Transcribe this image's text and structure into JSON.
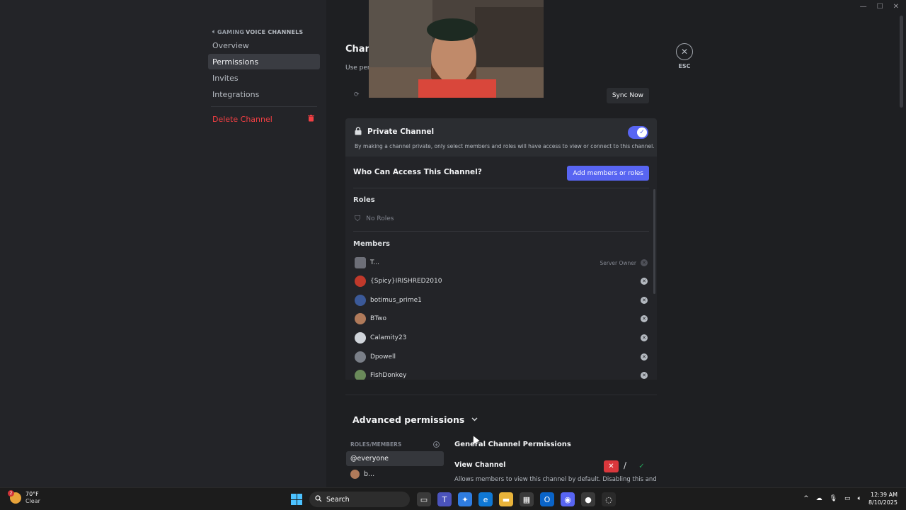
{
  "window": {
    "minimize": "—",
    "maximize": "☐",
    "close": "✕"
  },
  "sidebar": {
    "header_category": "GAMING",
    "header_group": "VOICE CHANNELS",
    "items": [
      {
        "label": "Overview"
      },
      {
        "label": "Permissions"
      },
      {
        "label": "Invites"
      },
      {
        "label": "Integrations"
      }
    ],
    "delete_label": "Delete Channel"
  },
  "page": {
    "title": "Chann",
    "subtitle": "Use perm",
    "sync_label": "Sync Now",
    "esc_label": "ESC"
  },
  "private_channel": {
    "title": "Private Channel",
    "description": "By making a channel private, only select members and roles will have access to view or connect to this channel.",
    "enabled": true
  },
  "access": {
    "heading": "Who Can Access This Channel?",
    "add_button": "Add members or roles",
    "roles_label": "Roles",
    "no_roles": "No Roles",
    "members_label": "Members",
    "members": [
      {
        "name": "T...",
        "tag": "Server Owner",
        "color": "#6d6f78"
      },
      {
        "name": "{Spicy}IRISHRED2010",
        "tag": "",
        "color": "#c0392b"
      },
      {
        "name": "botimus_prime1",
        "tag": "",
        "color": "#3b5998"
      },
      {
        "name": "BTwo",
        "tag": "",
        "color": "#b07a5a"
      },
      {
        "name": "Calamity23",
        "tag": "",
        "color": "#d0d4da"
      },
      {
        "name": "Dpowell",
        "tag": "",
        "color": "#7a7f88"
      },
      {
        "name": "FishDonkey",
        "tag": "",
        "color": "#6a8a5a"
      }
    ]
  },
  "advanced": {
    "title": "Advanced permissions",
    "roles_members_label": "ROLES/MEMBERS",
    "list": [
      {
        "label": "@everyone"
      },
      {
        "label": "b..."
      }
    ],
    "section_title": "General Channel Permissions",
    "permission_name": "View Channel",
    "permission_desc": "Allows members to view this channel by default. Disabling this and",
    "slash": "/"
  },
  "taskbar": {
    "temperature": "70°F",
    "condition": "Clear",
    "weather_badge": "2",
    "search_label": "Search",
    "time": "12:39 AM",
    "date": "8/10/2025"
  }
}
